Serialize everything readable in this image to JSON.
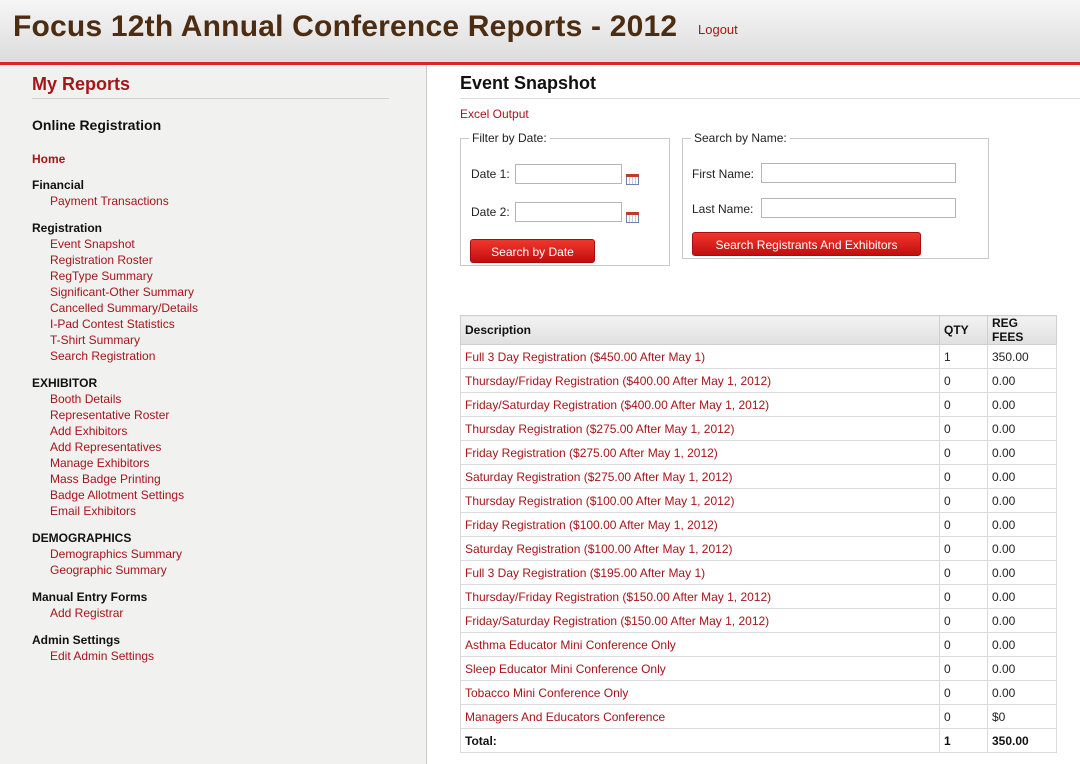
{
  "header": {
    "title": "Focus 12th Annual Conference Reports - 2012",
    "logout_label": "Logout"
  },
  "sidebar": {
    "title": "My Reports",
    "subtitle": "Online Registration",
    "home_label": "Home",
    "sections": [
      {
        "title": "Financial",
        "links": [
          "Payment Transactions"
        ]
      },
      {
        "title": "Registration",
        "links": [
          "Event Snapshot",
          "Registration Roster",
          "RegType Summary",
          "Significant-Other Summary",
          "Cancelled Summary/Details",
          "I-Pad Contest Statistics",
          "T-Shirt Summary",
          "Search Registration"
        ]
      },
      {
        "title": "EXHIBITOR",
        "links": [
          "Booth Details",
          "Representative Roster",
          "Add Exhibitors",
          "Add Representatives",
          "Manage Exhibitors",
          "Mass Badge Printing",
          "Badge Allotment Settings",
          "Email Exhibitors"
        ]
      },
      {
        "title": "DEMOGRAPHICS",
        "links": [
          "Demographics Summary",
          "Geographic Summary"
        ]
      },
      {
        "title": "Manual Entry Forms",
        "links": [
          "Add Registrar"
        ]
      },
      {
        "title": "Admin Settings",
        "links": [
          "Edit Admin Settings"
        ]
      }
    ]
  },
  "main": {
    "page_title": "Event Snapshot",
    "excel_label": "Excel Output",
    "date_filter": {
      "legend": "Filter by Date:",
      "date1_label": "Date 1:",
      "date1_value": "",
      "date2_label": "Date 2:",
      "date2_value": "",
      "button_label": "Search by Date"
    },
    "name_search": {
      "legend": "Search by Name:",
      "first_label": "First Name:",
      "first_value": "",
      "last_label": "Last Name:",
      "last_value": "",
      "button_label": "Search Registrants And Exhibitors"
    },
    "table": {
      "headers": [
        "Description",
        "QTY",
        "REG FEES"
      ],
      "rows": [
        [
          "Full 3 Day Registration ($450.00 After May 1)",
          "1",
          "350.00"
        ],
        [
          "Thursday/Friday Registration ($400.00 After May 1, 2012)",
          "0",
          "0.00"
        ],
        [
          "Friday/Saturday Registration ($400.00 After May 1, 2012)",
          "0",
          "0.00"
        ],
        [
          "Thursday Registration ($275.00 After May 1, 2012)",
          "0",
          "0.00"
        ],
        [
          "Friday Registration ($275.00 After May 1, 2012)",
          "0",
          "0.00"
        ],
        [
          "Saturday Registration ($275.00 After May 1, 2012)",
          "0",
          "0.00"
        ],
        [
          "Thursday Registration ($100.00 After May 1, 2012)",
          "0",
          "0.00"
        ],
        [
          "Friday Registration ($100.00 After May 1, 2012)",
          "0",
          "0.00"
        ],
        [
          "Saturday Registration ($100.00 After May 1, 2012)",
          "0",
          "0.00"
        ],
        [
          "Full 3 Day Registration ($195.00 After May 1)",
          "0",
          "0.00"
        ],
        [
          "Thursday/Friday Registration ($150.00 After May 1, 2012)",
          "0",
          "0.00"
        ],
        [
          "Friday/Saturday Registration ($150.00 After May 1, 2012)",
          "0",
          "0.00"
        ],
        [
          "Asthma Educator Mini Conference Only",
          "0",
          "0.00"
        ],
        [
          "Sleep Educator Mini Conference Only",
          "0",
          "0.00"
        ],
        [
          "Tobacco Mini Conference Only",
          "0",
          "0.00"
        ],
        [
          "Managers And Educators Conference",
          "0",
          "$0"
        ]
      ],
      "total": [
        "Total:",
        "1",
        "350.00"
      ]
    }
  }
}
